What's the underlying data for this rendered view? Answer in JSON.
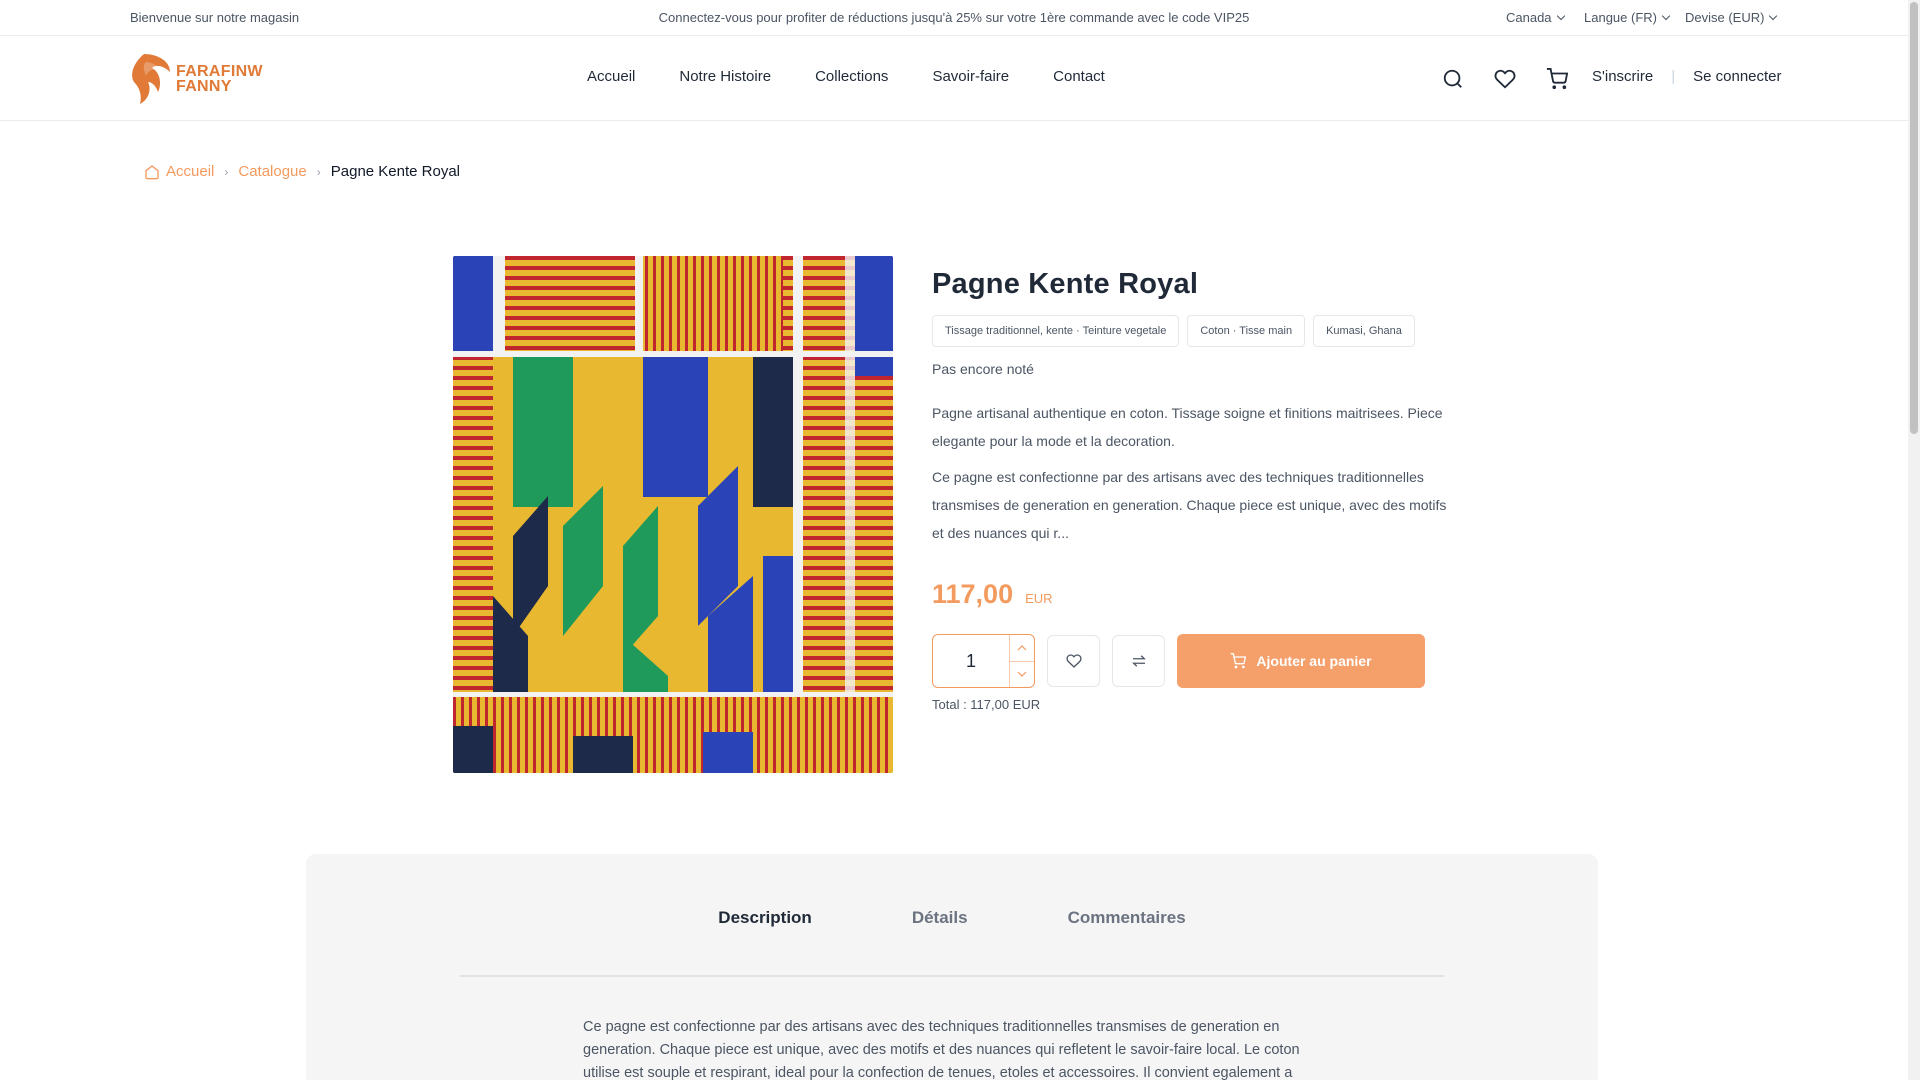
{
  "topbar": {
    "welcome": "Bienvenue sur notre magasin",
    "promo": "Connectez-vous pour profiter de réductions jusqu'à 25% sur votre 1ère commande avec le code VIP25",
    "country": "Canada",
    "language": "Langue (FR)",
    "currency": "Devise (EUR)"
  },
  "header": {
    "logo_line1": "FARAFINW",
    "logo_line2": "FANNY",
    "brand_color": "#e07a36",
    "nav": [
      "Accueil",
      "Notre Histoire",
      "Collections",
      "Savoir-faire",
      "Contact"
    ],
    "icons": [
      "search-icon",
      "heart-icon",
      "cart-icon"
    ],
    "register": "S'inscrire",
    "login": "Se connecter"
  },
  "breadcrumb": {
    "home": "Accueil",
    "catalogue": "Catalogue",
    "current": "Pagne Kente Royal"
  },
  "product": {
    "title": "Pagne Kente Royal",
    "tags": [
      "Tissage traditionnel, kente · Teinture vegetale",
      "Coton · Tisse main",
      "Kumasi, Ghana"
    ],
    "rating": "Pas encore noté",
    "description_short": "Pagne artisanal authentique en coton. Tissage soigne et finitions maitrisees. Piece elegante pour la mode et la decoration.",
    "description_long": "Ce pagne est confectionne par des artisans avec des techniques traditionnelles transmises de generation en generation. Chaque piece est unique, avec des motifs et des nuances qui r...",
    "price": "117,00",
    "currency": "EUR",
    "quantity": "1",
    "add_to_cart": "Ajouter au panier",
    "total": "Total : 117,00 EUR",
    "accent_color": "#f39a5e"
  },
  "tabs": {
    "items": [
      "Description",
      "Détails",
      "Commentaires"
    ],
    "active": "Description",
    "content": "Ce pagne est confectionne par des artisans avec des techniques traditionnelles transmises de generation en generation. Chaque piece est unique, avec des motifs et des nuances qui refletent le savoir-faire local. Le coton utilise est souple et respirant, ideal pour la confection de tenues, etoles et accessoires. Il convient egalement a"
  }
}
